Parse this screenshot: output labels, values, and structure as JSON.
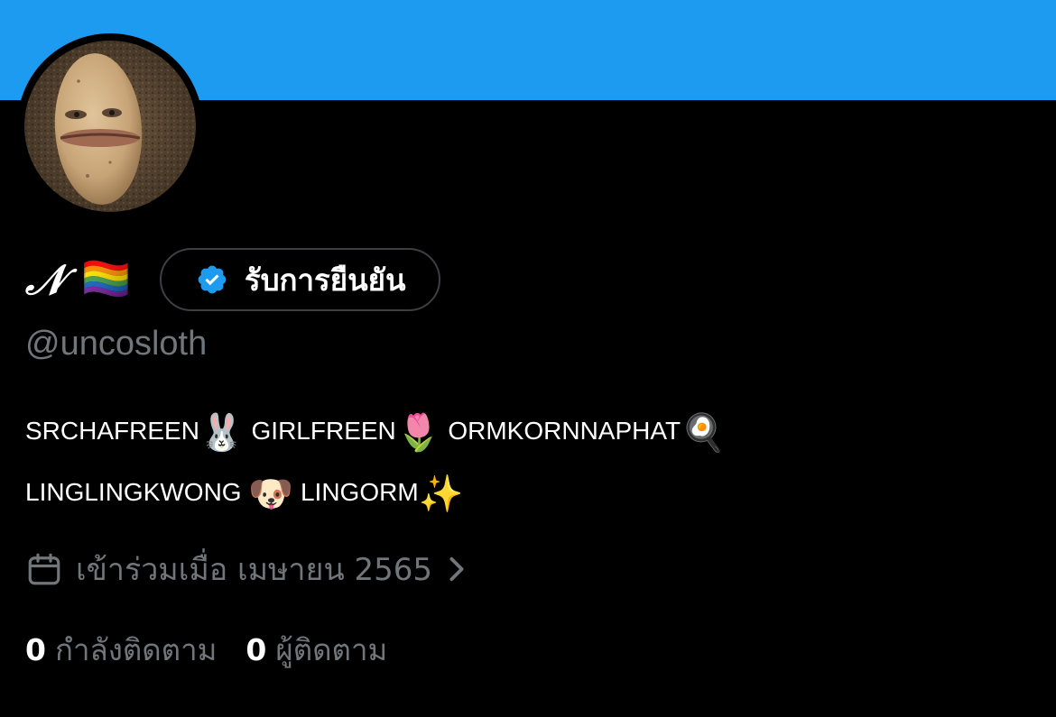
{
  "header": {
    "banner_color": "#1d9bf0"
  },
  "profile": {
    "avatar": "potato-face-avatar",
    "display_name": "𝒩",
    "flag_emoji": "🏳️‍🌈",
    "verify_button": {
      "icon": "verified-badge-icon",
      "label": "รับการยืนยัน"
    },
    "handle": "@uncosloth",
    "bio": {
      "line1": [
        {
          "text": "SRCHAFREEN",
          "emoji": "🐰"
        },
        {
          "text": "GIRLFREEN",
          "emoji": "🌷"
        },
        {
          "text": "ORMKORNNAPHAT",
          "emoji": "🍳"
        }
      ],
      "line2": [
        {
          "text": "LINGLINGKWONG",
          "emoji": "🐶"
        },
        {
          "text": "LINGORM",
          "emoji": "✨"
        }
      ]
    },
    "joined": {
      "icon": "calendar-icon",
      "text": "เข้าร่วมเมื่อ เมษายน 2565",
      "chevron": "chevron-right-icon"
    },
    "stats": {
      "following_count": "0",
      "following_label": "กำลังติดตาม",
      "followers_count": "0",
      "followers_label": "ผู้ติดตาม"
    }
  },
  "colors": {
    "background": "#000000",
    "accent": "#1d9bf0",
    "muted_text": "#71767b",
    "border": "#3c4043"
  }
}
